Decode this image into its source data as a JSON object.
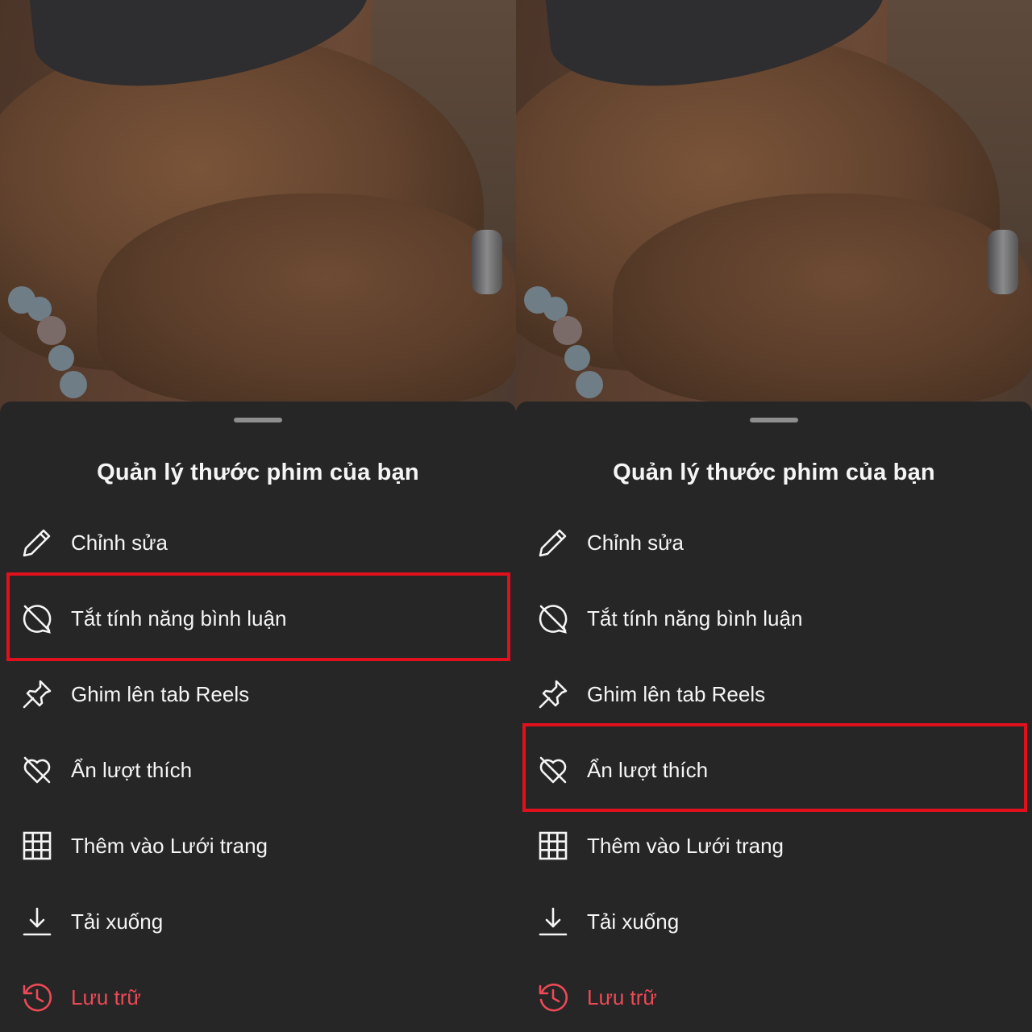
{
  "sheet": {
    "title": "Quản lý thước phim của bạn",
    "items": [
      {
        "label": "Chỉnh sửa",
        "icon": "pencil-icon"
      },
      {
        "label": "Tắt tính năng bình luận",
        "icon": "comment-off-icon"
      },
      {
        "label": "Ghim lên tab Reels",
        "icon": "pin-icon"
      },
      {
        "label": "Ẩn lượt thích",
        "icon": "heart-off-icon"
      },
      {
        "label": "Thêm vào Lưới trang",
        "icon": "grid-icon"
      },
      {
        "label": "Tải xuống",
        "icon": "download-icon"
      },
      {
        "label": "Lưu trữ",
        "icon": "archive-history-icon",
        "color": "#ed4956"
      }
    ]
  },
  "panels": [
    {
      "highlighted_item": "Tắt tính năng bình luận"
    },
    {
      "highlighted_item": "Ẩn lượt thích"
    }
  ],
  "colors": {
    "sheet_background": "#262626",
    "text": "#f5f5f5",
    "danger": "#ed4956",
    "highlight_box": "#e0101c"
  }
}
